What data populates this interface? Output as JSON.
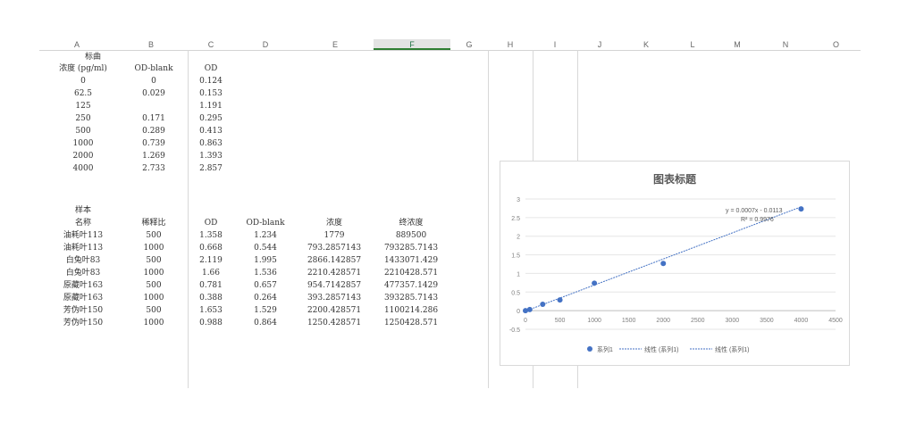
{
  "columns": [
    "A",
    "B",
    "C",
    "D",
    "E",
    "F",
    "G",
    "H",
    "I",
    "J",
    "K",
    "L",
    "M",
    "N",
    "O"
  ],
  "selected_column": "F",
  "std_block": {
    "title_line1": "标曲",
    "headers": [
      "浓度 (pg/ml)",
      "OD-blank",
      "OD"
    ],
    "rows": [
      [
        "0",
        "0",
        "0.124"
      ],
      [
        "62.5",
        "0.029",
        "0.153"
      ],
      [
        "125",
        "",
        "1.191"
      ],
      [
        "250",
        "0.171",
        "0.295"
      ],
      [
        "500",
        "0.289",
        "0.413"
      ],
      [
        "1000",
        "0.739",
        "0.863"
      ],
      [
        "2000",
        "1.269",
        "1.393"
      ],
      [
        "4000",
        "2.733",
        "2.857"
      ]
    ]
  },
  "sample_block": {
    "title_line1": "样本",
    "headers": [
      "名称",
      "稀释比",
      "OD",
      "OD-blank",
      "浓度",
      "终浓度"
    ],
    "rows": [
      [
        "油耗叶113",
        "500",
        "1.358",
        "1.234",
        "1779",
        "889500"
      ],
      [
        "油耗叶113",
        "1000",
        "0.668",
        "0.544",
        "793.2857143",
        "793285.7143"
      ],
      [
        "白兔叶83",
        "500",
        "2.119",
        "1.995",
        "2866.142857",
        "1433071.429"
      ],
      [
        "白兔叶83",
        "1000",
        "1.66",
        "1.536",
        "2210.428571",
        "2210428.571"
      ],
      [
        "原藏叶163",
        "500",
        "0.781",
        "0.657",
        "954.7142857",
        "477357.1429"
      ],
      [
        "原藏叶163",
        "1000",
        "0.388",
        "0.264",
        "393.2857143",
        "393285.7143"
      ],
      [
        "芳伪叶150",
        "500",
        "1.653",
        "1.529",
        "2200.428571",
        "1100214.286"
      ],
      [
        "芳伪叶150",
        "1000",
        "0.988",
        "0.864",
        "1250.428571",
        "1250428.571"
      ]
    ]
  },
  "chart_data": {
    "type": "scatter",
    "title": "图表标题",
    "x": [
      0,
      62.5,
      250,
      500,
      1000,
      2000,
      4000
    ],
    "series": [
      {
        "name": "系列1",
        "x": [
          0,
          62.5,
          250,
          500,
          1000,
          2000,
          4000
        ],
        "y": [
          0,
          0.029,
          0.171,
          0.289,
          0.739,
          1.269,
          2.733
        ],
        "color": "#4472c4"
      }
    ],
    "trendline": {
      "slope": 0.0007,
      "intercept": -0.0113
    },
    "equation_text": "y = 0.0007x - 0.0113",
    "r2_text": "R² = 0.9976",
    "xlim": [
      0,
      4500
    ],
    "ylim": [
      -0.5,
      3
    ],
    "xticks": [
      "0",
      "500",
      "1000",
      "1500",
      "2000",
      "2500",
      "3000",
      "3500",
      "4000",
      "4500"
    ],
    "yticks": [
      "-0.5",
      "0",
      "0.5",
      "1",
      "1.5",
      "2",
      "2.5",
      "3"
    ],
    "legend": [
      "系列1",
      "线性 (系列1)",
      "线性 (系列1)"
    ],
    "legend_position": "bottom",
    "grid": true
  }
}
